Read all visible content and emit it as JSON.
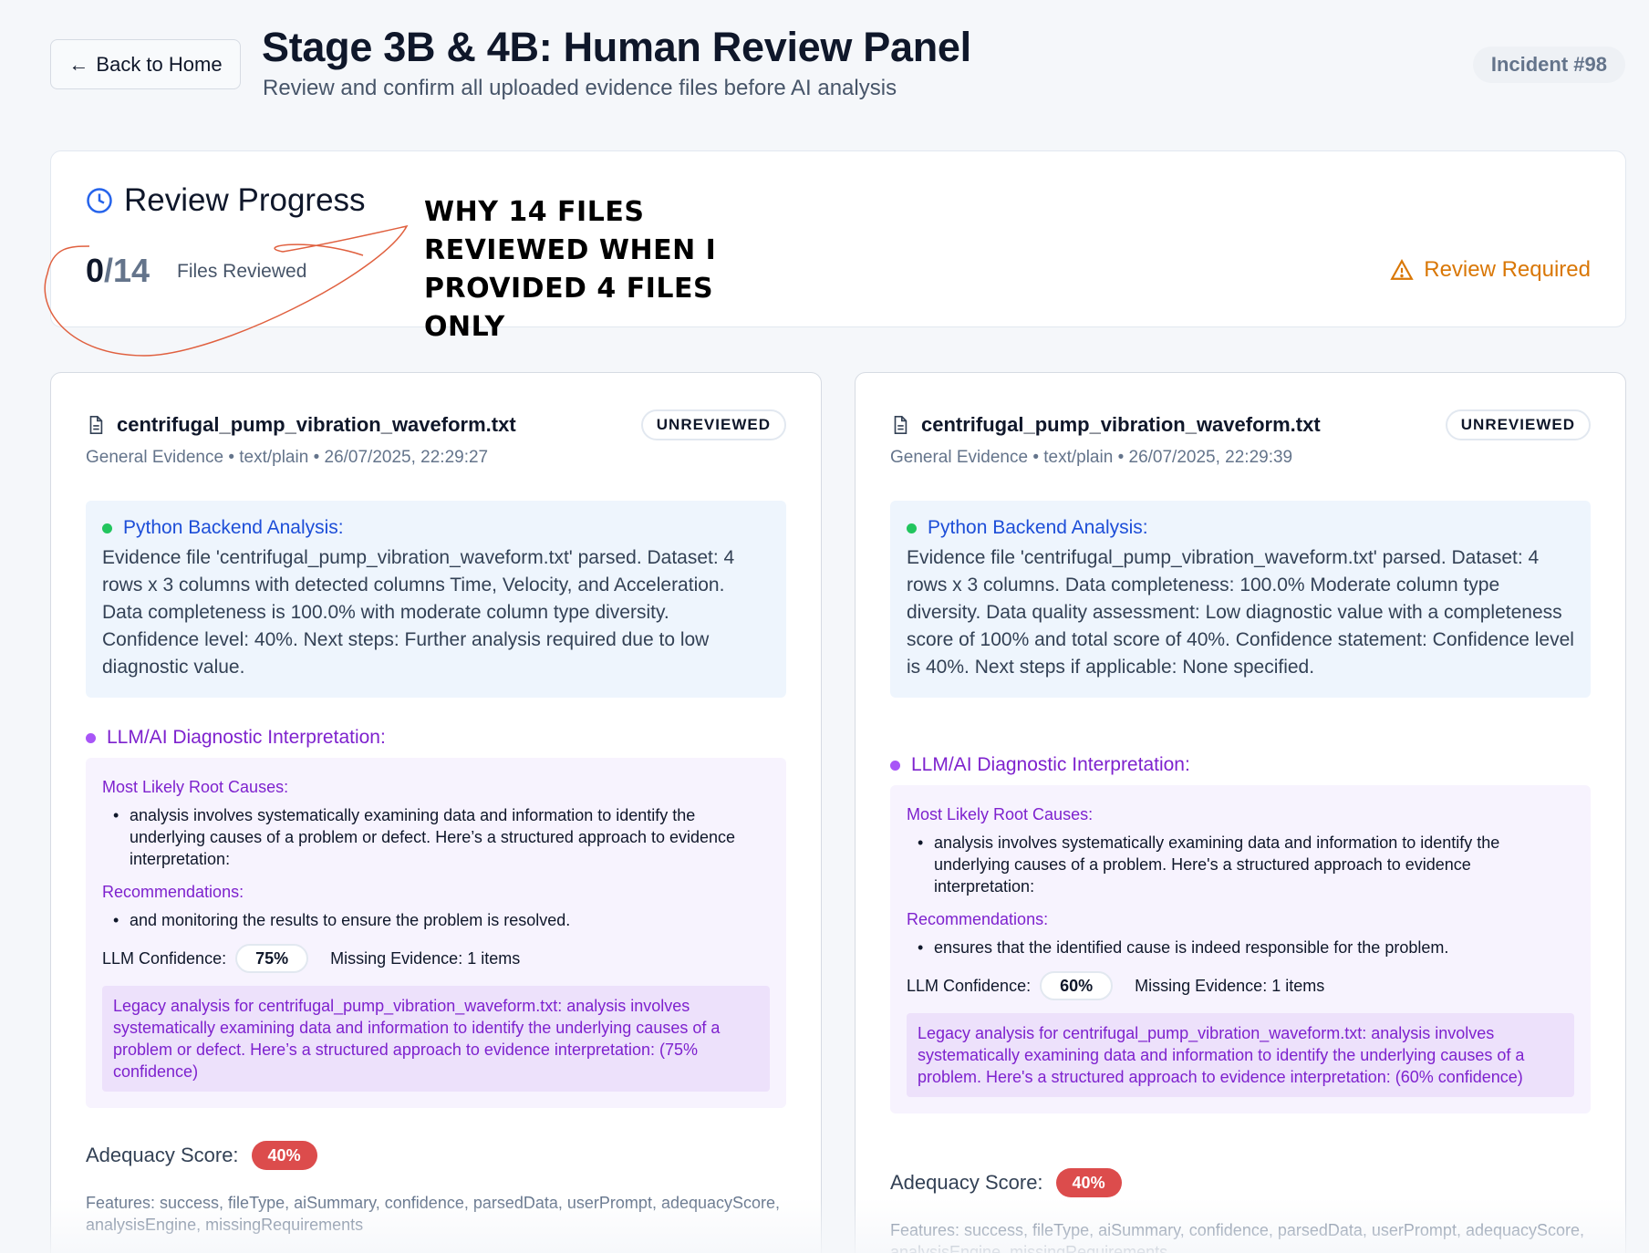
{
  "header": {
    "back_label": "Back to Home",
    "title": "Stage 3B & 4B: Human Review Panel",
    "subtitle": "Review and confirm all uploaded evidence files before AI analysis",
    "incident": "Incident #98"
  },
  "progress": {
    "title": "Review Progress",
    "reviewed": "0",
    "total": "/14",
    "label": "Files Reviewed",
    "status": "Review Required",
    "annotation": "WHY 14 FILES REVIEWED WHEN I PROVIDED 4 FILES ONLY",
    "annotation_color": "#e0603f"
  },
  "files": [
    {
      "name": "centrifugal_pump_vibration_waveform.txt",
      "status": "UNREVIEWED",
      "meta": "General Evidence • text/plain • 26/07/2025, 22:29:27",
      "backend_title": "Python Backend Analysis:",
      "backend_text": "Evidence file 'centrifugal_pump_vibration_waveform.txt' parsed. Dataset: 4 rows x 3 columns with detected columns Time, Velocity, and Acceleration. Data completeness is 100.0% with moderate column type diversity. Confidence level: 40%. Next steps: Further analysis required due to low diagnostic value.",
      "llm_title": "LLM/AI Diagnostic Interpretation:",
      "root_causes_label": "Most Likely Root Causes:",
      "root_cause": "analysis involves systematically examining data and information to identify the underlying causes of a problem or defect. Here’s a structured approach to evidence interpretation:",
      "recommendations_label": "Recommendations:",
      "recommendation": "and monitoring the results to ensure the problem is resolved.",
      "llm_conf_label": "LLM Confidence:",
      "llm_conf": "75%",
      "missing": "Missing Evidence: 1 items",
      "legacy": "Legacy analysis for centrifugal_pump_vibration_waveform.txt: analysis involves systematically examining data and information to identify the underlying causes of a problem or defect. Here’s a structured approach to evidence interpretation: (75% confidence)",
      "adequacy_label": "Adequacy Score:",
      "adequacy": "40%",
      "features": "Features: success, fileType, aiSummary, confidence, parsedData, userPrompt, adequacyScore, analysisEngine, missingRequirements"
    },
    {
      "name": "centrifugal_pump_vibration_waveform.txt",
      "status": "UNREVIEWED",
      "meta": "General Evidence • text/plain • 26/07/2025, 22:29:39",
      "backend_title": "Python Backend Analysis:",
      "backend_text": "Evidence file 'centrifugal_pump_vibration_waveform.txt' parsed. Dataset: 4 rows x 3 columns. Data completeness: 100.0% Moderate column type diversity. Data quality assessment: Low diagnostic value with a completeness score of 100% and total score of 40%. Confidence statement: Confidence level is 40%. Next steps if applicable: None specified.",
      "llm_title": "LLM/AI Diagnostic Interpretation:",
      "root_causes_label": "Most Likely Root Causes:",
      "root_cause": "analysis involves systematically examining data and information to identify the underlying causes of a problem. Here's a structured approach to evidence interpretation:",
      "recommendations_label": "Recommendations:",
      "recommendation": "ensures that the identified cause is indeed responsible for the problem.",
      "llm_conf_label": "LLM Confidence:",
      "llm_conf": "60%",
      "missing": "Missing Evidence: 1 items",
      "legacy": "Legacy analysis for centrifugal_pump_vibration_waveform.txt: analysis involves systematically examining data and information to identify the underlying causes of a problem. Here's a structured approach to evidence interpretation: (60% confidence)",
      "adequacy_label": "Adequacy Score:",
      "adequacy": "40%",
      "features": "Features: success, fileType, aiSummary, confidence, parsedData, userPrompt, adequacyScore, analysisEngine, missingRequirements"
    }
  ]
}
